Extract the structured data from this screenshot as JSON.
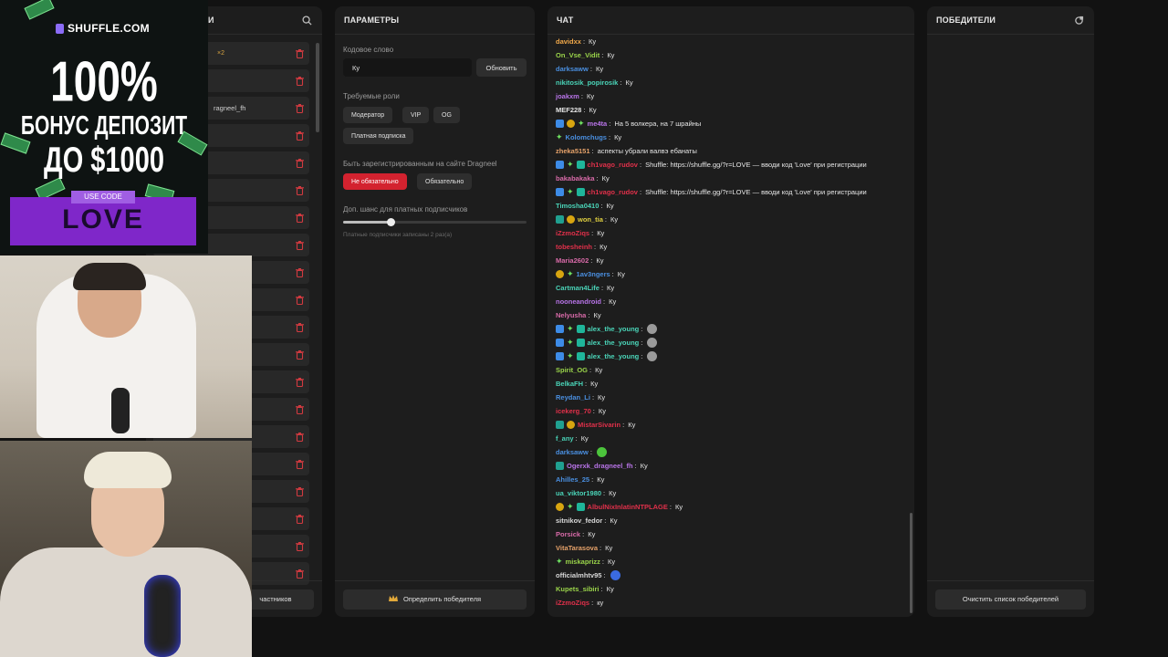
{
  "participants": {
    "title_visible": "И",
    "first_row_suffix": "×2",
    "third_row_text": "ragneel_fh",
    "footer_button": "частников",
    "row_count": 20
  },
  "params": {
    "title": "ПАРАМЕТРЫ",
    "keyword_label": "Кодовое слово",
    "keyword_value": "Ку",
    "update_button": "Обновить",
    "roles_label": "Требуемые роли",
    "roles": [
      "Модератор",
      "VIP",
      "OG",
      "Платная подписка"
    ],
    "registered_label": "Быть зарегистрированным на сайте Dragneel",
    "registered_options": [
      "Не обязательно",
      "Обязательно"
    ],
    "registered_selected": "Не обязательно",
    "bonus_label": "Доп. шанс для платных подписчиков",
    "bonus_value": 0.26,
    "bonus_note": "Платные подписчики записаны 2 раз(а)",
    "pick_button": "Определить победителя",
    "pick_icon": "crown-icon"
  },
  "chat": {
    "title": "ЧАТ",
    "messages": [
      {
        "user": "davidxx",
        "color": "#f2a94a",
        "badges": [],
        "text": "Ку"
      },
      {
        "user": "On_Vse_Vidit",
        "color": "#9ad44a",
        "badges": [],
        "text": "Ку"
      },
      {
        "user": "darksaww",
        "color": "#4a8fe0",
        "badges": [],
        "text": "Ку"
      },
      {
        "user": "nikitosik_popirosik",
        "color": "#4ad4b8",
        "badges": [],
        "text": "Ку"
      },
      {
        "user": "joakxm",
        "color": "#b874e8",
        "badges": [],
        "text": "Ку"
      },
      {
        "user": "MEF228",
        "color": "#e6e6e6",
        "badges": [],
        "text": "Ку"
      },
      {
        "user": "me4ta",
        "color": "#b874e8",
        "badges": [
          "blue",
          "gold",
          "green"
        ],
        "text": "На 5 волкера, на 7 шрайны"
      },
      {
        "user": "Kolomchugs",
        "color": "#4a8fe0",
        "badges": [
          "green"
        ],
        "text": "Ку"
      },
      {
        "user": "zheka5151",
        "color": "#e6a26a",
        "badges": [],
        "text": "аспекты убрали валвэ ебанаты"
      },
      {
        "user": "ch1vago_rudov",
        "color": "#e0304a",
        "badges": [
          "blue",
          "green",
          "gift"
        ],
        "text": "Shuffle: https://shuffle.gg/?r=LOVE — вводи код 'Love' при регистрации"
      },
      {
        "user": "bakabakaka",
        "color": "#d86aa8",
        "badges": [],
        "text": "Ку"
      },
      {
        "user": "ch1vago_rudov",
        "color": "#e0304a",
        "badges": [
          "blue",
          "green",
          "gift"
        ],
        "text": "Shuffle: https://shuffle.gg/?r=LOVE — вводи код 'Love' при регистрации"
      },
      {
        "user": "Timosha0410",
        "color": "#4ad4b8",
        "badges": [],
        "text": "Ку"
      },
      {
        "user": "won_tia",
        "color": "#e0d040",
        "badges": [
          "teal",
          "gold"
        ],
        "text": "Ку"
      },
      {
        "user": "iZzmoZiqs",
        "color": "#e0304a",
        "badges": [],
        "text": "Ку"
      },
      {
        "user": "tobesheinh",
        "color": "#e0304a",
        "badges": [],
        "text": "Ку"
      },
      {
        "user": "Maria2602",
        "color": "#d86aa8",
        "badges": [],
        "text": "Ку"
      },
      {
        "user": "1av3ngers",
        "color": "#4a8fe0",
        "badges": [
          "gold",
          "green"
        ],
        "text": "Ку"
      },
      {
        "user": "Cartman4Life",
        "color": "#4ad4b8",
        "badges": [],
        "text": "Ку"
      },
      {
        "user": "nooneandroid",
        "color": "#b874e8",
        "badges": [],
        "text": "Ку"
      },
      {
        "user": "Nelyusha",
        "color": "#d86aa8",
        "badges": [],
        "text": "Ку"
      },
      {
        "user": "alex_the_young",
        "color": "#4ad4b8",
        "badges": [
          "blue",
          "green",
          "gift"
        ],
        "text": "",
        "emote": "#9a9a9a"
      },
      {
        "user": "alex_the_young",
        "color": "#4ad4b8",
        "badges": [
          "blue",
          "green",
          "gift"
        ],
        "text": "",
        "emote": "#9a9a9a"
      },
      {
        "user": "alex_the_young",
        "color": "#4ad4b8",
        "badges": [
          "blue",
          "green",
          "gift"
        ],
        "text": "",
        "emote": "#9a9a9a"
      },
      {
        "user": "Spirit_OG",
        "color": "#9ad44a",
        "badges": [],
        "text": "Ку"
      },
      {
        "user": "BelkaFH",
        "color": "#4ad4b8",
        "badges": [],
        "text": "Ку"
      },
      {
        "user": "Reydan_Li",
        "color": "#4a8fe0",
        "badges": [],
        "text": "Ку"
      },
      {
        "user": "icekerg_70",
        "color": "#e0304a",
        "badges": [],
        "text": "Ку"
      },
      {
        "user": "MistarSivarin",
        "color": "#e0304a",
        "badges": [
          "teal",
          "gold"
        ],
        "text": "Ку"
      },
      {
        "user": "f_any",
        "color": "#4ad4b8",
        "badges": [],
        "text": "Ку"
      },
      {
        "user": "darksaww",
        "color": "#4a8fe0",
        "badges": [],
        "text": "",
        "emote": "#4cc43c"
      },
      {
        "user": "Ogerxk_dragneel_fh",
        "color": "#b874e8",
        "badges": [
          "teal"
        ],
        "text": "Ку"
      },
      {
        "user": "Ahilles_25",
        "color": "#4a8fe0",
        "badges": [],
        "text": "Ку"
      },
      {
        "user": "ua_viktor1980",
        "color": "#4ad4b8",
        "badges": [],
        "text": "Ку"
      },
      {
        "user": "AlbulNixInlatinNTPLAGE",
        "color": "#e0304a",
        "badges": [
          "gold",
          "green",
          "gift"
        ],
        "text": "Ку"
      },
      {
        "user": "sitnikov_fedor",
        "color": "#d8d8d8",
        "badges": [],
        "text": "Ку"
      },
      {
        "user": "Porsick",
        "color": "#d86aa8",
        "badges": [],
        "text": "Ку"
      },
      {
        "user": "VitaTarasova",
        "color": "#e6a26a",
        "badges": [],
        "text": "Ку"
      },
      {
        "user": "miskaprizz",
        "color": "#9ad44a",
        "badges": [
          "green"
        ],
        "text": "Ку"
      },
      {
        "user": "officialmhtv95",
        "color": "#d8d8d8",
        "badges": [],
        "text": "",
        "emote": "#3a6ae0"
      },
      {
        "user": "Kupets_sibiri",
        "color": "#9ad44a",
        "badges": [],
        "text": "Ку"
      },
      {
        "user": "iZzmoZiqs",
        "color": "#e0304a",
        "badges": [],
        "text": "ку"
      }
    ]
  },
  "winners": {
    "title": "ПОБЕДИТЕЛИ",
    "header_icon": "refresh-icon",
    "clear_button": "Очистить список победителей"
  },
  "ad": {
    "brand": "SHUFFLE.COM",
    "line1": "100%",
    "line2": "БОНУС ДЕПОЗИТ",
    "line3": "ДО $1000",
    "code_label": "USE CODE",
    "code": "LOVE"
  },
  "colors": {
    "accent_red": "#d3222f",
    "panel_bg": "#1d1d1d",
    "page_bg": "#121212",
    "promo_purple": "#7f27c9"
  }
}
